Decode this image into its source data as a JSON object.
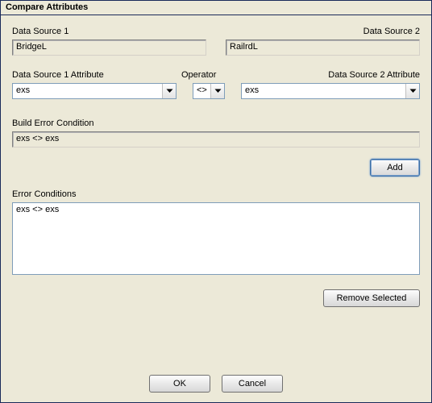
{
  "window": {
    "title": "Compare Attributes"
  },
  "labels": {
    "ds1": "Data Source 1",
    "ds2": "Data Source 2",
    "ds1attr": "Data Source 1 Attribute",
    "operator": "Operator",
    "ds2attr": "Data Source 2 Attribute",
    "build_error": "Build Error Condition",
    "error_conditions": "Error Conditions"
  },
  "values": {
    "ds1": "BridgeL",
    "ds2": "RailrdL",
    "ds1attr": "exs",
    "operator": "<>",
    "ds2attr": "exs",
    "build_error": "exs <> exs",
    "error_conditions": [
      "exs <> exs"
    ]
  },
  "buttons": {
    "add": "Add",
    "remove_selected": "Remove Selected",
    "ok": "OK",
    "cancel": "Cancel"
  },
  "icons": {
    "chevron_down": "chevron-down-icon"
  }
}
